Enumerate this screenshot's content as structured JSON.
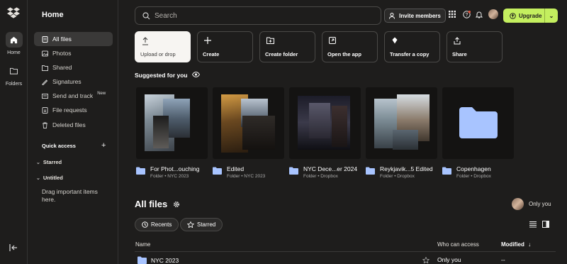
{
  "rail": {
    "items": [
      {
        "label": "Home",
        "icon": "home-icon"
      },
      {
        "label": "Folders",
        "icon": "folder-icon"
      }
    ]
  },
  "sidebar": {
    "title": "Home",
    "items": [
      {
        "label": "All files",
        "icon": "files-icon",
        "active": true
      },
      {
        "label": "Photos",
        "icon": "photos-icon"
      },
      {
        "label": "Shared",
        "icon": "shared-icon"
      },
      {
        "label": "Signatures",
        "icon": "signature-icon"
      },
      {
        "label": "Send and track",
        "icon": "send-icon",
        "badge": "New"
      },
      {
        "label": "File requests",
        "icon": "file-request-icon"
      },
      {
        "label": "Deleted files",
        "icon": "trash-icon"
      }
    ],
    "quick_access": "Quick access",
    "starred": "Starred",
    "untitled": "Untitled",
    "hint": "Drag important items here."
  },
  "header": {
    "search_placeholder": "Search",
    "invite_label": "Invite members",
    "upgrade_label": "Upgrade"
  },
  "actions": [
    {
      "label": "Upload or drop",
      "icon": "upload-icon"
    },
    {
      "label": "Create",
      "icon": "plus-icon"
    },
    {
      "label": "Create folder",
      "icon": "create-folder-icon"
    },
    {
      "label": "Open the app",
      "icon": "open-app-icon"
    },
    {
      "label": "Transfer a copy",
      "icon": "transfer-icon"
    },
    {
      "label": "Share",
      "icon": "share-icon"
    }
  ],
  "suggested": {
    "title": "Suggested for you",
    "items": [
      {
        "name": "For Phot...ouching",
        "meta": "Folder • NYC 2023"
      },
      {
        "name": "Edited",
        "meta": "Folder • NYC 2023"
      },
      {
        "name": "NYC Dece...er 2024",
        "meta": "Folder • Dropbox"
      },
      {
        "name": "Reykjavik...5 Edited",
        "meta": "Folder • Dropbox"
      },
      {
        "name": "Copenhagen",
        "meta": "Folder • Dropbox"
      }
    ]
  },
  "all_files": {
    "title": "All files",
    "access_label": "Only you",
    "filters": [
      "Recents",
      "Starred"
    ],
    "columns": {
      "name": "Name",
      "access": "Who can access",
      "modified": "Modified"
    },
    "rows": [
      {
        "name": "NYC 2023",
        "access": "Only you",
        "modified": "--"
      }
    ]
  },
  "colors": {
    "background": "#1e1d1c",
    "accent": "#c4ef5f",
    "folder": "#a8c4ff"
  }
}
